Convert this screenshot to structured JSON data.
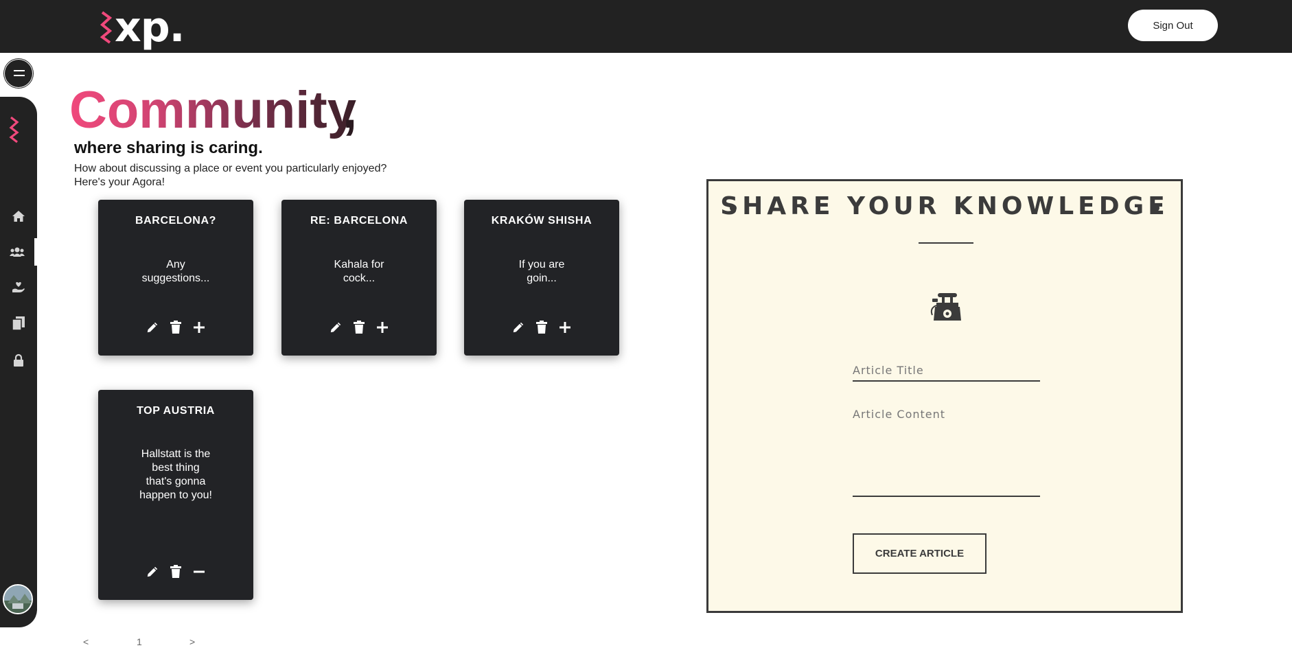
{
  "header": {
    "logo_text": "xp.",
    "sign_out_label": "Sign Out",
    "brand_color": "#f0497c"
  },
  "sidebar": {
    "items": [
      {
        "name": "home-icon",
        "label": "home"
      },
      {
        "name": "community-icon",
        "label": "community",
        "active": true
      },
      {
        "name": "heart-hand-icon",
        "label": "favorites"
      },
      {
        "name": "documents-icon",
        "label": "documents"
      },
      {
        "name": "lock-icon",
        "label": "locked"
      }
    ]
  },
  "hero": {
    "title": "Community",
    "comma": ",",
    "subtitle": "where sharing is caring.",
    "description": "How about discussing a place or event you particularly enjoyed? Here's your Agora!"
  },
  "cards": [
    {
      "title": "BARCELONA?",
      "body": "Any suggestions...",
      "third_action": "plus"
    },
    {
      "title": "RE: BARCELONA",
      "body": "Kahala for cock...",
      "third_action": "plus"
    },
    {
      "title": "KRAKÓW SHISHA",
      "body": "If you are goin...",
      "third_action": "plus"
    },
    {
      "title": "TOP AUSTRIA",
      "body": "Hallstatt is the best thing that's gonna happen to you!",
      "third_action": "minus"
    }
  ],
  "pagination": {
    "prev": "<",
    "current": "1",
    "next": ">"
  },
  "share": {
    "title": "SHARE YOUR KNOWLEDGE",
    "title_placeholder": "Article Title",
    "content_placeholder": "Article Content",
    "button_label": "CREATE ARTICLE",
    "icon": "vintage-telephone-icon",
    "background_color": "#fdf9e8"
  }
}
